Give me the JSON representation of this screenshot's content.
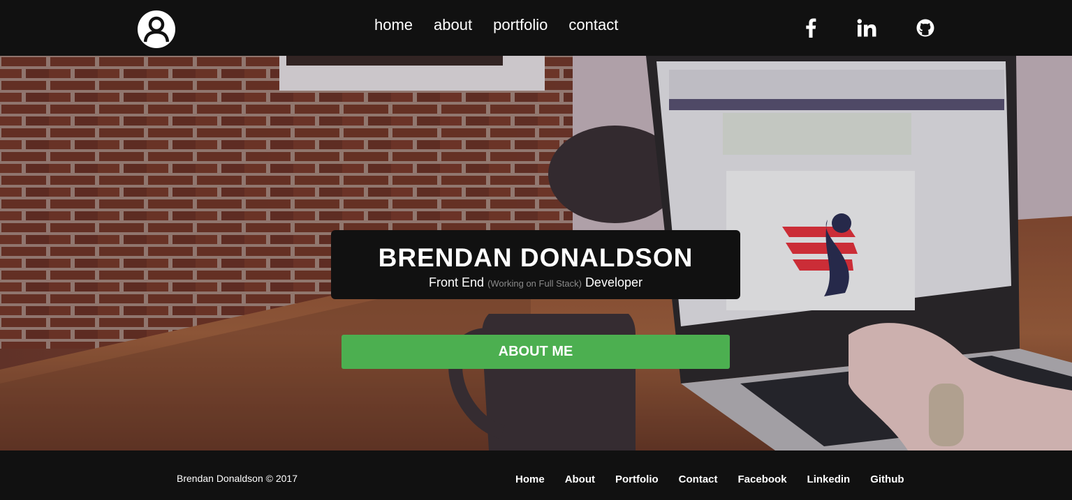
{
  "nav": {
    "logo_icon": "user-avatar-icon",
    "links": [
      "home",
      "about",
      "portfolio",
      "contact"
    ],
    "social": [
      {
        "name": "facebook",
        "icon": "facebook-icon"
      },
      {
        "name": "linkedin",
        "icon": "linkedin-icon"
      },
      {
        "name": "github",
        "icon": "github-icon"
      }
    ]
  },
  "hero": {
    "name": "BRENDAN DONALDSON",
    "subtitle_prefix": "Front End",
    "subtitle_note": "(Working on Full Stack)",
    "subtitle_suffix": "Developer",
    "button_label": "ABOUT ME"
  },
  "footer": {
    "copyright": "Brendan Donaldson © 2017",
    "links": [
      "Home",
      "About",
      "Portfolio",
      "Contact",
      "Facebook",
      "Linkedin",
      "Github"
    ]
  },
  "colors": {
    "bar_bg": "#111111",
    "accent_green": "#4caf50",
    "text": "#ffffff"
  }
}
